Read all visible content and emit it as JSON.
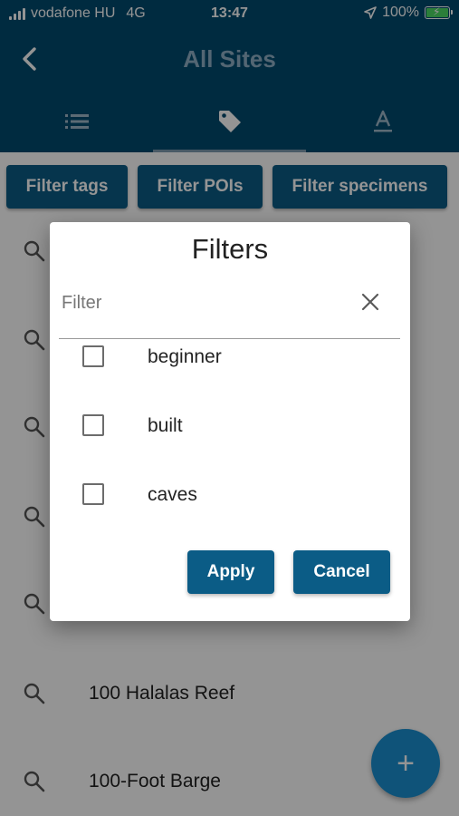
{
  "status_bar": {
    "carrier": "vodafone HU",
    "network": "4G",
    "time": "13:47",
    "battery": "100%",
    "battery_level": 1.0,
    "icons": [
      "signal-bars-icon",
      "location-arrow-icon",
      "battery-charging-icon"
    ]
  },
  "header": {
    "title": "All Sites",
    "back_icon": "back-chevron-icon"
  },
  "tabs": [
    {
      "icon": "list-icon",
      "active": false
    },
    {
      "icon": "tag-icon",
      "active": true
    },
    {
      "icon": "text-format-icon",
      "active": false
    }
  ],
  "filter_bar": {
    "tags": "Filter tags",
    "pois": "Filter POIs",
    "specimens": "Filter specimens"
  },
  "list": {
    "items": [
      "100 Halalas Reef",
      "100-Foot Barge"
    ]
  },
  "fab": {
    "label": "+"
  },
  "dialog": {
    "title": "Filters",
    "filter_placeholder": "Filter",
    "filter_value": "",
    "options": [
      {
        "label": "beginner",
        "checked": false
      },
      {
        "label": "built",
        "checked": false
      },
      {
        "label": "caves",
        "checked": false
      }
    ],
    "apply": "Apply",
    "cancel": "Cancel"
  },
  "colors": {
    "header_bg": "#004a6e",
    "button_bg": "#0b5c86",
    "fab_bg": "#1a8fd0",
    "battery_green": "#4cd964"
  }
}
